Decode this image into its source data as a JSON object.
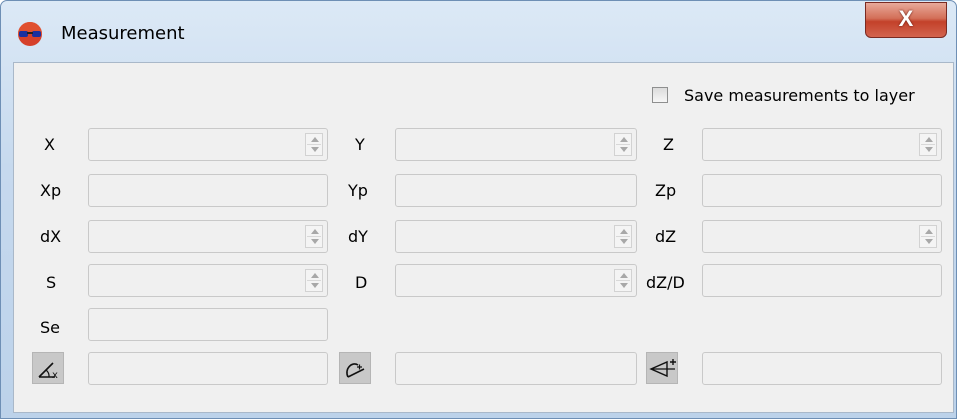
{
  "window": {
    "title": "Measurement",
    "close_label": "X"
  },
  "options": {
    "save_label": "Save measurements to layer",
    "save_checked": false
  },
  "fields": {
    "x": "X",
    "y": "Y",
    "z": "Z",
    "xp": "Xp",
    "yp": "Yp",
    "zp": "Zp",
    "dx": "dX",
    "dy": "dY",
    "dz": "dZ",
    "s": "S",
    "d": "D",
    "dzd": "dZ/D",
    "se": "Se"
  },
  "tools": [
    {
      "icon": "angle-x-icon"
    },
    {
      "icon": "angle-arc-icon"
    },
    {
      "icon": "cone-plus-icon"
    }
  ]
}
